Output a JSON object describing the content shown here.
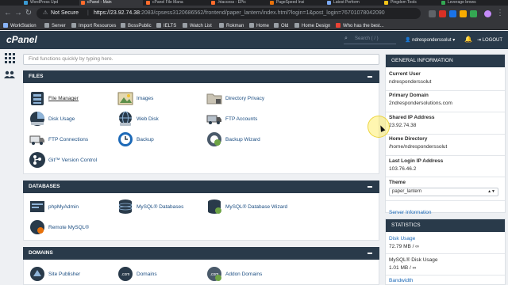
{
  "browser": {
    "tabs": [
      {
        "title": "WordPress Upd"
      },
      {
        "title": "cPanel - Main",
        "active": true
      },
      {
        "title": "cPanel File Mana"
      },
      {
        "title": ".htaccess - EPic"
      },
      {
        "title": "PageSpeed Insi"
      },
      {
        "title": "Latest Perform"
      },
      {
        "title": "Pingdom Tools"
      },
      {
        "title": "Leverage brows"
      }
    ],
    "security_label": "Not Secure",
    "url_host": "https://23.92.74.38",
    "url_rest": ":2083/cpsess3120686562/frontend/paper_lantern/index.html?login=1&post_login=76701078042090",
    "bookmarks": [
      "WorkStation",
      "Server",
      "Import Resources",
      "BossPublic",
      "IELTS",
      "Watch List",
      "Rokman",
      "Home",
      "Old",
      "Home Design",
      "Who has the best..."
    ]
  },
  "cpanel": {
    "logo": "cPanel",
    "search_placeholder": "Search ( / )",
    "username": "ndresponderssolut",
    "logout": "LOGOUT"
  },
  "main": {
    "find_placeholder": "Find functions quickly by typing here.",
    "sections": {
      "files": {
        "title": "FILES",
        "items": [
          "File Manager",
          "Images",
          "Directory Privacy",
          "Disk Usage",
          "Web Disk",
          "FTP Accounts",
          "FTP Connections",
          "Backup",
          "Backup Wizard",
          "Git™ Version Control"
        ]
      },
      "databases": {
        "title": "DATABASES",
        "items": [
          "phpMyAdmin",
          "MySQL® Databases",
          "MySQL® Database Wizard",
          "Remote MySQL®"
        ]
      },
      "domains": {
        "title": "DOMAINS",
        "items": [
          "Site Publisher",
          "Domains",
          "Addon Domains"
        ]
      }
    }
  },
  "general_info": {
    "title": "GENERAL INFORMATION",
    "current_user_label": "Current User",
    "current_user": "ndresponderssolut",
    "primary_domain_label": "Primary Domain",
    "primary_domain": "2ndrespondersolutions.com",
    "shared_ip_label": "Shared IP Address",
    "shared_ip": "23.92.74.38",
    "home_dir_label": "Home Directory",
    "home_dir": "/home/ndresponderssolut",
    "last_login_label": "Last Login IP Address",
    "last_login": "103.76.46.2",
    "theme_label": "Theme",
    "theme_value": "paper_lantern",
    "server_info": "Server Information"
  },
  "statistics": {
    "title": "STATISTICS",
    "disk_usage_label": "Disk Usage",
    "disk_usage_value": "72.79 MB / ∞",
    "mysql_disk_label": "MySQL® Disk Usage",
    "mysql_disk_value": "1.01 MB / ∞",
    "bandwidth_label": "Bandwidth"
  },
  "colors": {
    "header_navy": "#293a4a",
    "link_blue": "#1c69b7",
    "page_bg": "#eef0f3"
  }
}
